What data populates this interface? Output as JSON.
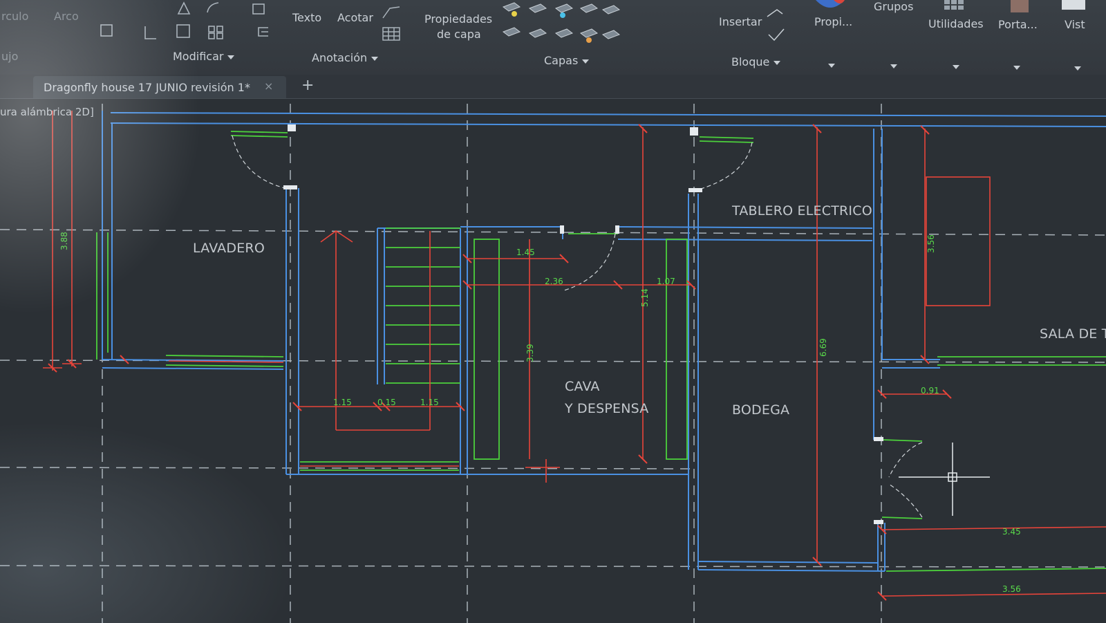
{
  "ribbon": {
    "left_labels": [
      "rculo",
      "Arco",
      "ujo"
    ],
    "texto_label": "Texto",
    "acotar_label": "Acotar",
    "propiedades_line1": "Propiedades",
    "propiedades_line2": "de capa",
    "insertar_label": "Insertar",
    "propiedades_short": "Propi...",
    "grupos_label": "Grupos",
    "utilidades_label": "Utilidades",
    "portapapeles_label": "Porta...",
    "vista_label": "Vist",
    "panels": {
      "modificar": "Modificar",
      "anotacion": "Anotación",
      "capas": "Capas",
      "bloque": "Bloque"
    }
  },
  "tabs": {
    "document": "Dragonfly house 17 JUNIO revisión 1*",
    "close_symbol": "×",
    "new_symbol": "+"
  },
  "viewport": {
    "label": "ura alámbrica 2D]"
  },
  "rooms": {
    "lavadero": "LAVADERO",
    "tablero": "TABLERO ELECTRICO",
    "cava_line1": "CAVA",
    "cava_line2": "Y DESPENSA",
    "bodega": "BODEGA",
    "sala": "SALA DE T"
  },
  "dimensions": {
    "d_145": "1.45",
    "d_236": "2.36",
    "d_107": "1.07",
    "d_115a": "1.15",
    "d_015": "0.15",
    "d_115b": "1.15",
    "d_091": "0.91",
    "d_345": "3.45",
    "d_356b": "3.56",
    "v_388": "3.88",
    "v_514": "5.14",
    "v_339": "3.39",
    "v_669": "6.69",
    "v_356": "3.56"
  },
  "colors": {
    "wall_blue": "#4a90e2",
    "dim_red": "#e8443a",
    "green": "#4cd13c",
    "background": "#2b3035"
  }
}
